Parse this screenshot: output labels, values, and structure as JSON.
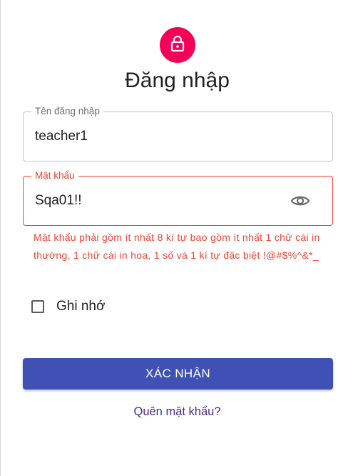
{
  "header": {
    "title": "Đăng nhập",
    "avatar_icon": "lock-icon",
    "avatar_color": "#f50057"
  },
  "form": {
    "username": {
      "label": "Tên đăng nhập",
      "value": "teacher1"
    },
    "password": {
      "label": "Mật khẩu",
      "value": "Sqa01!!",
      "toggle_icon": "eye-icon",
      "error": "Mật khẩu phải gồm ít nhất 8 kí tự bao gồm ít nhất 1 chữ cái in thường, 1 chữ cái in hoa, 1 số và 1 kí tự đặc biệt !@#$%^&*_"
    },
    "remember": {
      "label": "Ghi nhớ",
      "checked": false
    },
    "submit_label": "XÁC NHẬN",
    "forgot_label": "Quên mật khẩu?"
  },
  "colors": {
    "primary": "#3f51b5",
    "error": "#f44336",
    "link": "#4a2b8a"
  }
}
